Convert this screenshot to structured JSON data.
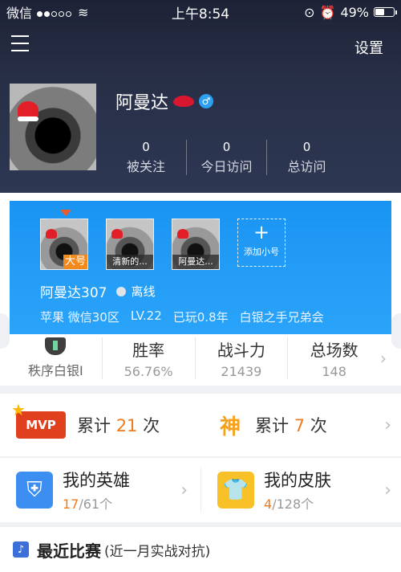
{
  "status_bar": {
    "carrier": "微信",
    "wifi_icon": "wifi-icon",
    "time": "上午8:54",
    "battery_percent": "49%",
    "battery_level": 0.49
  },
  "header": {
    "settings_label": "设置",
    "menu_icon": "menu-icon"
  },
  "profile": {
    "name": "阿曼达",
    "stats": [
      {
        "value": "0",
        "label": "被关注"
      },
      {
        "value": "0",
        "label": "今日访问"
      },
      {
        "value": "0",
        "label": "总访问"
      }
    ]
  },
  "game_card": {
    "accounts": [
      {
        "tag": "大号"
      },
      {
        "tag": "清新的..."
      },
      {
        "tag": "阿曼达..."
      }
    ],
    "add_account_label": "添加小号",
    "role_name": "阿曼达307",
    "status": "离线",
    "info": [
      "苹果 微信30区",
      "LV.22",
      "已玩0.8年",
      "白银之手兄弟会"
    ],
    "rank": {
      "label": "秩序白银Ⅰ",
      "win_rate_title": "胜率",
      "win_rate_value": "56.76%",
      "power_title": "战斗力",
      "power_value": "21439",
      "games_title": "总场数",
      "games_value": "148"
    }
  },
  "mvp": {
    "badge": "MVP",
    "prefix": "累计",
    "mvp_count": "21",
    "suffix": "次",
    "shen_badge": "神",
    "shen_count": "7"
  },
  "collection": {
    "hero_title": "我的英雄",
    "hero_owned": "17",
    "hero_total": "/61个",
    "skin_title": "我的皮肤",
    "skin_owned": "4",
    "skin_total": "/128个"
  },
  "recent": {
    "title": "最近比赛",
    "subtitle": "(近一月实战对抗)"
  },
  "colors": {
    "header_bg": "#283048",
    "card_blue": "#1a94f2",
    "accent_orange": "#f07b1e",
    "mvp_red": "#e1401f"
  }
}
